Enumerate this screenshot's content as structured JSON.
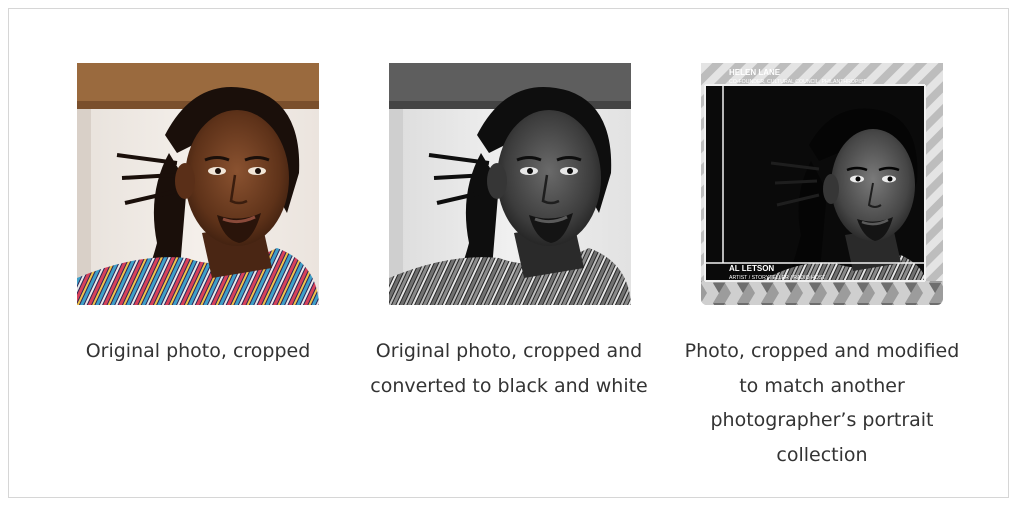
{
  "figures": [
    {
      "caption_lines": [
        "Original photo, cropped"
      ]
    },
    {
      "caption_lines": [
        "Original photo, cropped and",
        "converted to black and white"
      ]
    },
    {
      "caption_lines": [
        "Photo, cropped and modified",
        "to match another",
        "photographer’s portrait",
        "collection"
      ],
      "overlay": {
        "top_name": "HELEN LANE",
        "top_role": "CO-FOUNDER, CULTURAL COUNCIL, PHILANTHROPIST",
        "bottom_name": "AL LETSON",
        "bottom_role": "ARTIST / STORYTELLER / RADIO HOST"
      }
    }
  ],
  "colors": {
    "frame_border": "#d6d6d6",
    "caption_text": "#333333"
  }
}
